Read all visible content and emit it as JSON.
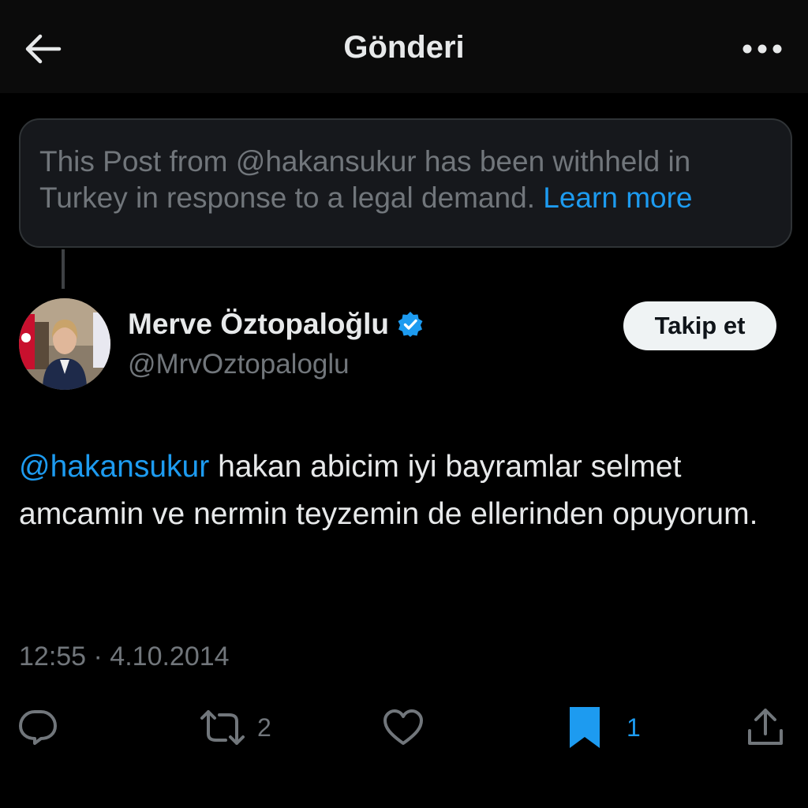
{
  "header": {
    "title": "Gönderi",
    "back_icon": "arrow-left-icon",
    "more_icon": "more-horizontal-icon"
  },
  "notice": {
    "text": "This Post from @hakansukur has been withheld in Turkey in response to a legal demand.",
    "link_label": "Learn more"
  },
  "author": {
    "name": "Merve Öztopaloğlu",
    "handle": "@MrvOztopaloglu",
    "verified_icon": "verified-badge-icon",
    "follow_label": "Takip et"
  },
  "post": {
    "mention": "@hakansukur",
    "body": "hakan abicim iyi bayramlar  selmet amcamin ve nermin teyzemin de ellerinden opuyorum.",
    "timestamp": "12:55 · 4.10.2014"
  },
  "actions": {
    "reply": {
      "icon": "reply-icon",
      "count": ""
    },
    "repost": {
      "icon": "repost-icon",
      "count": "2"
    },
    "like": {
      "icon": "heart-icon",
      "count": ""
    },
    "bookmark": {
      "icon": "bookmark-filled-icon",
      "count": "1"
    },
    "share": {
      "icon": "share-icon",
      "count": ""
    }
  },
  "colors": {
    "background": "#000000",
    "accent": "#1d9bf0",
    "text_primary": "#e7e9ea",
    "text_secondary": "#71767b",
    "notice_bg": "#16181c"
  }
}
